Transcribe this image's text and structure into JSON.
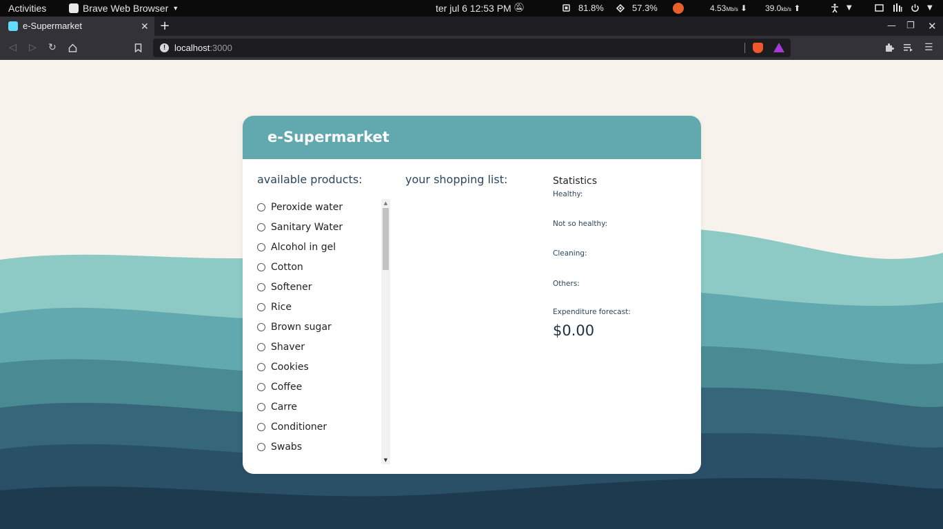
{
  "system_bar": {
    "activities": "Activities",
    "app_name": "Brave Web Browser",
    "clock": "ter jul 6  12:53 PM",
    "cpu": "81.8%",
    "memory": "57.3%",
    "net_down": "4.53",
    "net_down_unit": "Mb/s",
    "net_up": "39.0",
    "net_up_unit": "kb/s"
  },
  "browser": {
    "tab_title": "e-Supermarket",
    "url_host": "localhost",
    "url_port": ":3000"
  },
  "app": {
    "title": "e-Supermarket",
    "products_heading": "available products:",
    "shopping_list_heading": "your shopping list:",
    "statistics_heading": "Statistics",
    "products": [
      "Peroxide water",
      "Sanitary Water",
      "Alcohol in gel",
      "Cotton",
      "Softener",
      "Rice",
      "Brown sugar",
      "Shaver",
      "Cookies",
      "Coffee",
      "Carre",
      "Conditioner",
      "Swabs"
    ],
    "stats": {
      "healthy": "Healthy:",
      "not_so_healthy": "Not so healthy:",
      "cleaning": "Cleaning:",
      "others": "Others:",
      "expenditure_forecast": "Expenditure forecast:",
      "total": "$0.00"
    }
  },
  "colors": {
    "header": "#61a9ae",
    "page_bg": "#f7f3ec",
    "wave_1": "#8dcac5",
    "wave_2": "#61a9ae",
    "wave_3": "#4a8b93",
    "wave_4": "#35667a",
    "wave_5": "#2a5068",
    "wave_6": "#1d3a4e"
  },
  "icons": {
    "bell": "bell-muted-icon",
    "cpu": "cpu-icon",
    "memory": "memory-icon",
    "accessibility": "accessibility-icon",
    "power": "power-icon"
  }
}
